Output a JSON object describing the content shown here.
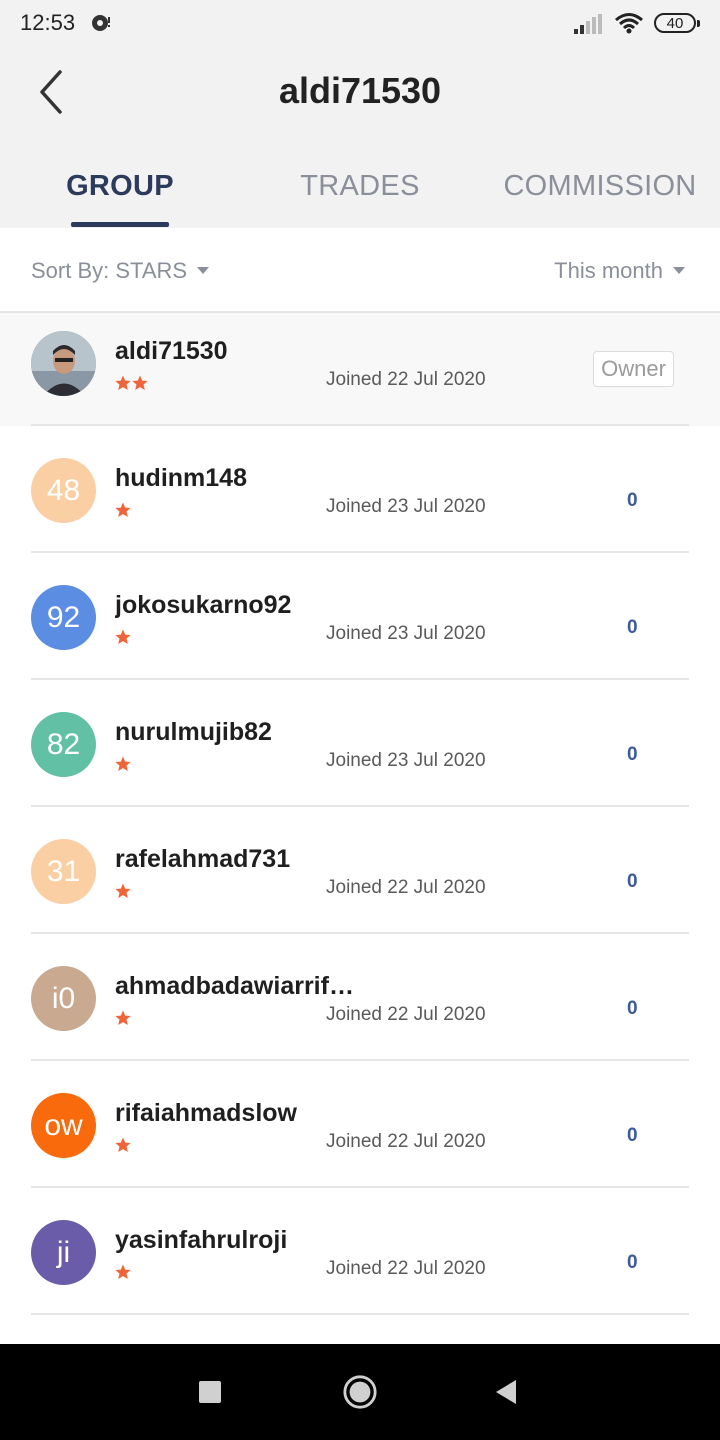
{
  "status_bar": {
    "time": "12:53",
    "battery": "40",
    "icons": [
      "notification-icon",
      "signal-icon",
      "wifi-icon",
      "battery-icon"
    ]
  },
  "header": {
    "title": "aldi71530",
    "back_icon": "chevron-left-icon"
  },
  "tabs": [
    {
      "label": "GROUP",
      "active": true
    },
    {
      "label": "TRADES",
      "active": false
    },
    {
      "label": "COMMISSION",
      "active": false
    }
  ],
  "sort": {
    "sort_label": "Sort By: STARS",
    "period_label": "This month"
  },
  "members": [
    {
      "name": "aldi71530",
      "stars": 2,
      "joined": "Joined 22 Jul 2020",
      "badge": "Owner",
      "avatar": "photo",
      "avatar_color": "#7a8a99"
    },
    {
      "name": "hudinm148",
      "stars": 1,
      "joined": "Joined 23 Jul 2020",
      "count": "0",
      "avatar": "48",
      "avatar_color": "#f9cfa3"
    },
    {
      "name": "jokosukarno92",
      "stars": 1,
      "joined": "Joined 23 Jul 2020",
      "count": "0",
      "avatar": "92",
      "avatar_color": "#5b8de2"
    },
    {
      "name": "nurulmujib82",
      "stars": 1,
      "joined": "Joined 23 Jul 2020",
      "count": "0",
      "avatar": "82",
      "avatar_color": "#62c0a5"
    },
    {
      "name": "rafelahmad731",
      "stars": 1,
      "joined": "Joined 22 Jul 2020",
      "count": "0",
      "avatar": "31",
      "avatar_color": "#f9cfa3"
    },
    {
      "name": "ahmadbadawiarrif…",
      "stars": 1,
      "joined": "Joined 22 Jul 2020",
      "count": "0",
      "avatar": "i0",
      "avatar_color": "#c9a98f"
    },
    {
      "name": "rifaiahmadslow",
      "stars": 1,
      "joined": "Joined 22 Jul 2020",
      "count": "0",
      "avatar": "ow",
      "avatar_color": "#f96a0c"
    },
    {
      "name": "yasinfahrulroji",
      "stars": 1,
      "joined": "Joined 22 Jul 2020",
      "count": "0",
      "avatar": "ji",
      "avatar_color": "#6a5ca8"
    }
  ],
  "colors": {
    "accent": "#2c3a5c",
    "star": "#f0643a",
    "count": "#3b5b9a"
  },
  "nav_bar": {
    "icons": [
      "recents-square-icon",
      "home-circle-icon",
      "back-triangle-icon"
    ]
  }
}
